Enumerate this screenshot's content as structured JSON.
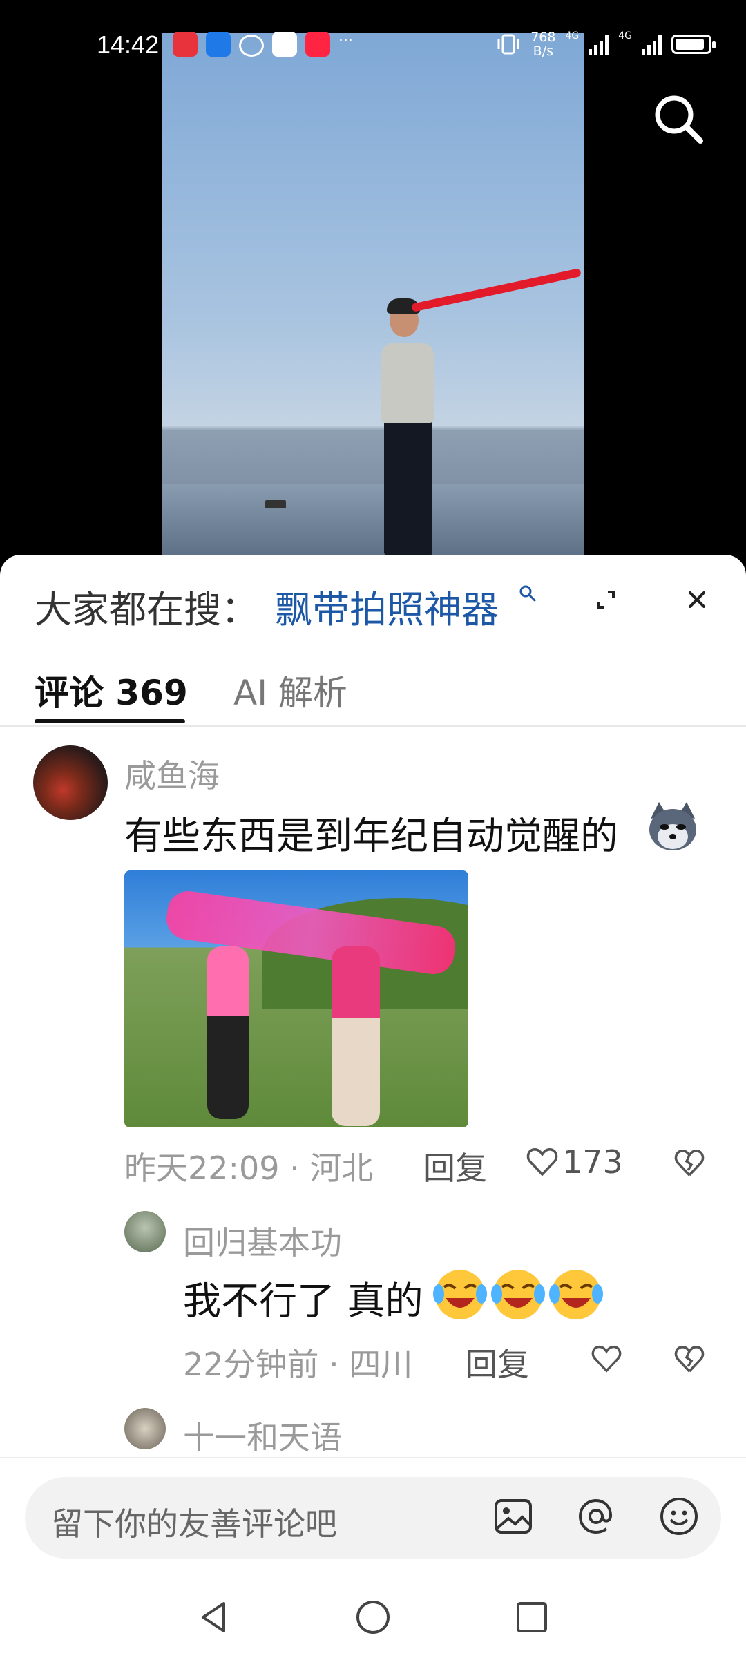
{
  "status_bar": {
    "time": "14:42",
    "net_speed_value": "768",
    "net_speed_unit": "B/s",
    "network_1": "4G",
    "network_2": "4G",
    "app_icons": [
      "huawei-icon",
      "baidu-icon",
      "message-icon",
      "china-mobile-icon",
      "xiaohongshu-icon"
    ],
    "more": "···"
  },
  "video": {
    "search_icon": "search-icon"
  },
  "sheet": {
    "hot_search_prefix": "大家都在搜：",
    "hot_search_term": "飘带拍照神器",
    "expand_icon": "expand-icon",
    "close_icon": "close-icon"
  },
  "tabs": [
    {
      "label": "评论 369",
      "active": true
    },
    {
      "label": "AI 解析",
      "active": false
    }
  ],
  "comments": [
    {
      "username": "咸鱼海",
      "text": "有些东西是到年纪自动觉醒的",
      "emoji": "wolf-sticker",
      "has_image": true,
      "meta": "昨天22:09 · 河北",
      "reply_label": "回复",
      "likes": "173",
      "replies": [
        {
          "username": "回归基本功",
          "text": "我不行了 真的",
          "emoji": "laugh-cry-emoji x3",
          "meta": "22分钟前 · 四川",
          "reply_label": "回复"
        },
        {
          "username": "十一和天语"
        }
      ]
    }
  ],
  "input": {
    "placeholder": "留下你的友善评论吧",
    "icons": [
      "image-icon",
      "at-icon",
      "emoji-icon"
    ]
  },
  "navbar": [
    "back-icon",
    "home-icon",
    "recent-apps-icon"
  ],
  "colors": {
    "accent_blue": "#1c58a6",
    "muted_text": "#9a9a9a",
    "ribbon_red": "#e21a2a"
  }
}
